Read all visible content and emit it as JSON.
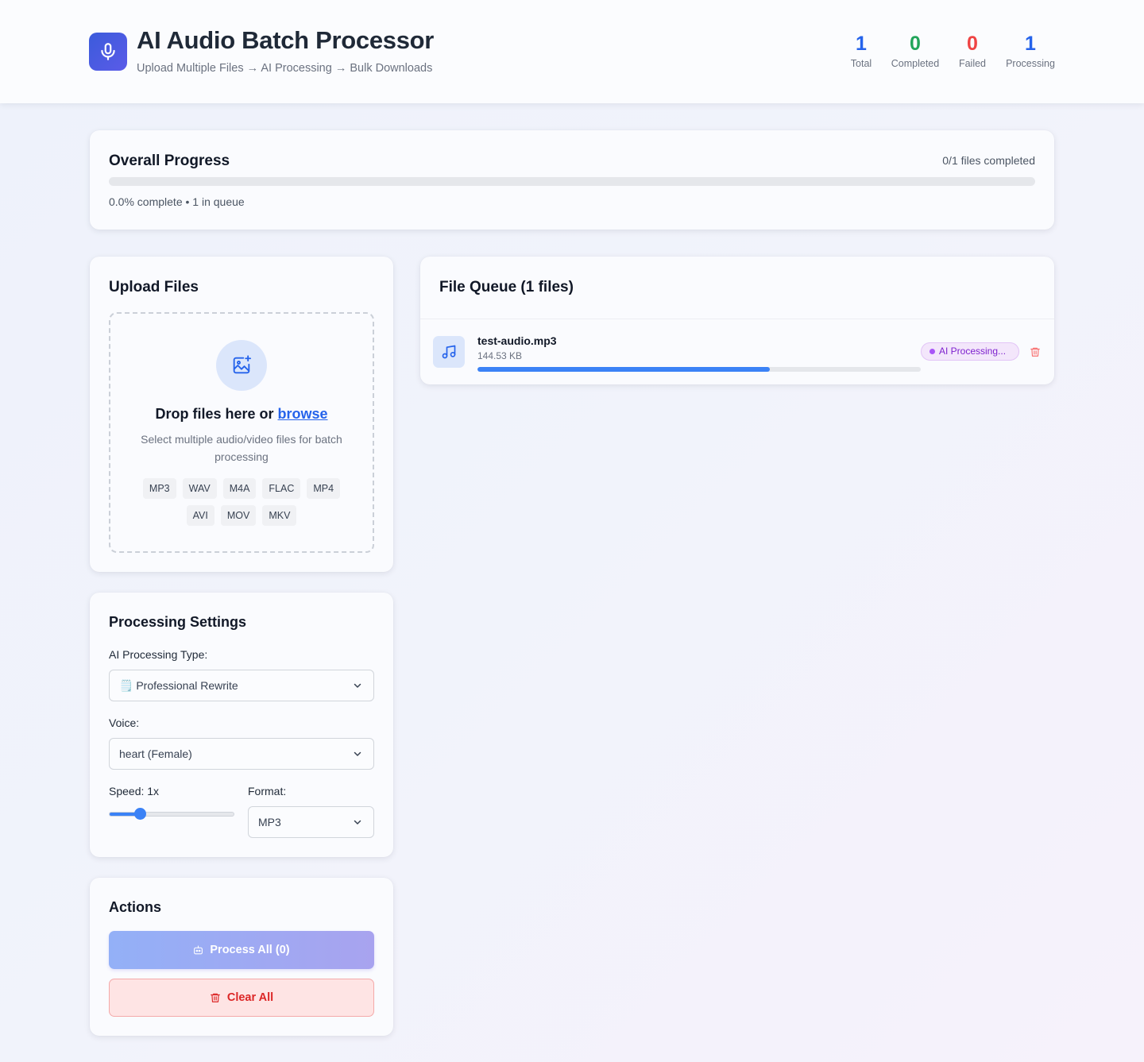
{
  "header": {
    "title": "AI Audio Batch Processor",
    "subtitle": "Upload Multiple Files → AI Processing → Bulk Downloads",
    "logo_icon": "microphone-icon",
    "stats": {
      "total": {
        "value": "1",
        "label": "Total",
        "color": "#2563eb"
      },
      "completed": {
        "value": "0",
        "label": "Completed",
        "color": "#22a55a"
      },
      "failed": {
        "value": "0",
        "label": "Failed",
        "color": "#ef4444"
      },
      "processing": {
        "value": "1",
        "label": "Processing",
        "color": "#2563eb"
      }
    }
  },
  "overall_progress": {
    "title": "Overall Progress",
    "count": "0/1 files completed",
    "percent": 0,
    "summary": "0.0% complete • 1 in queue"
  },
  "upload": {
    "title": "Upload Files",
    "drop_text": "Drop files here or ",
    "browse_link": "browse",
    "description": "Select multiple audio/video files for batch processing",
    "formats_row1": [
      "MP3",
      "WAV",
      "M4A",
      "FLAC",
      "MP4"
    ],
    "formats_row2": [
      "AVI",
      "MOV",
      "MKV"
    ],
    "icon": "image-add-icon"
  },
  "settings": {
    "title": "Processing Settings",
    "processing_type_label": "AI Processing Type:",
    "processing_type_value": "🗒️ Professional Rewrite",
    "voice_label": "Voice:",
    "voice_value": "heart (Female)",
    "speed_label": "Speed: 1x",
    "speed_value": 1,
    "format_label": "Format:",
    "format_value": "MP3"
  },
  "actions": {
    "title": "Actions",
    "process_all_label": "Process All (0)",
    "clear_all_label": "Clear All"
  },
  "queue": {
    "title": "File Queue (1 files)",
    "files": [
      {
        "name": "test-audio.mp3",
        "size": "144.53 KB",
        "status": "AI Processing...",
        "progress": 0.66,
        "icon": "music-note-icon"
      }
    ]
  }
}
